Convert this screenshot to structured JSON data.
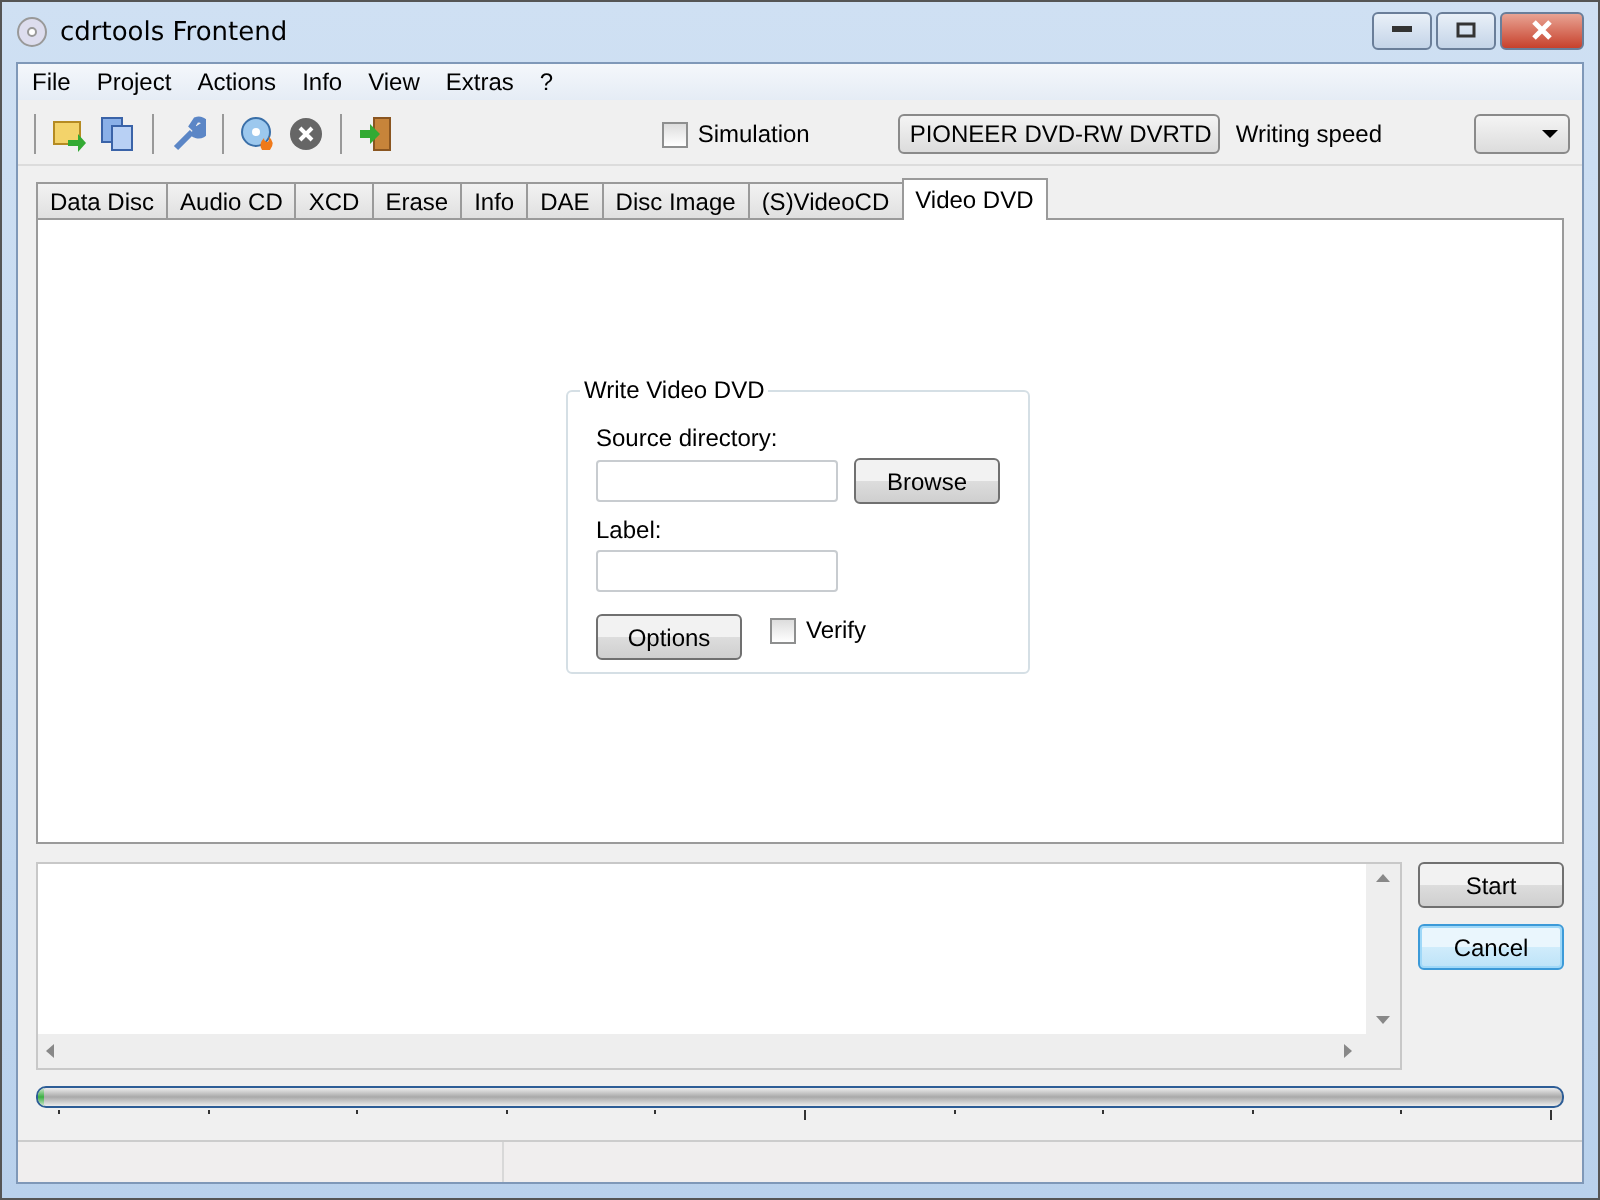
{
  "window": {
    "title": "cdrtools Frontend"
  },
  "menu": [
    "File",
    "Project",
    "Actions",
    "Info",
    "View",
    "Extras",
    "?"
  ],
  "toolbar": {
    "simulation": {
      "label": "Simulation",
      "checked": false
    },
    "drive": {
      "value": "PIONEER DVD-RW DVRTD"
    },
    "speed_label": "Writing speed"
  },
  "tabs": [
    {
      "label": "Data Disc",
      "selected": false
    },
    {
      "label": "Audio CD",
      "selected": false
    },
    {
      "label": "XCD",
      "selected": false
    },
    {
      "label": "Erase",
      "selected": false
    },
    {
      "label": "Info",
      "selected": false
    },
    {
      "label": "DAE",
      "selected": false
    },
    {
      "label": "Disc Image",
      "selected": false
    },
    {
      "label": "(S)VideoCD",
      "selected": false
    },
    {
      "label": "Video DVD",
      "selected": true
    }
  ],
  "group": {
    "title": "Write Video DVD",
    "source_label": "Source directory:",
    "browse": "Browse",
    "label_label": "Label:",
    "options": "Options",
    "verify": {
      "label": "Verify",
      "checked": false
    }
  },
  "buttons": [
    "Start",
    "Cancel"
  ],
  "progress": {
    "level": 0
  }
}
